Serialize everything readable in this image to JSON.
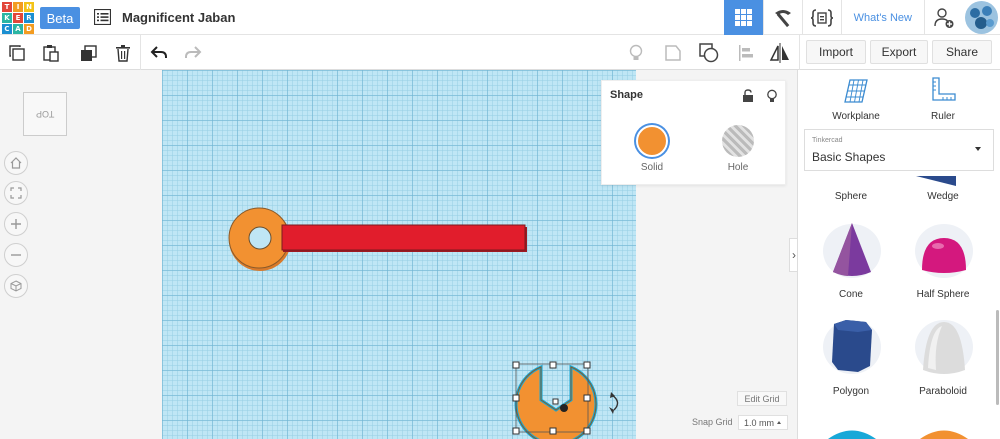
{
  "app": {
    "logo_letters": [
      "T",
      "I",
      "N",
      "K",
      "E",
      "R",
      "C",
      "A",
      "D"
    ],
    "logo_colors": [
      "#e2463a",
      "#f39c21",
      "#f3c318",
      "#2bb5a3",
      "#e2463a",
      "#1b8fd1",
      "#1b8fd1",
      "#2bb5a3",
      "#f39c21"
    ],
    "beta_label": "Beta",
    "design_title": "Magnificent Jaban",
    "whats_new_label": "What's New",
    "accent_color": "#4a90e2"
  },
  "toolbar": {
    "import_label": "Import",
    "export_label": "Export",
    "share_label": "Share"
  },
  "viewcube": {
    "face_label": "TOP"
  },
  "shape_panel": {
    "title": "Shape",
    "solid_label": "Solid",
    "hole_label": "Hole",
    "solid_color": "#f29131"
  },
  "grid_controls": {
    "edit_grid_label": "Edit Grid",
    "snap_grid_label": "Snap Grid",
    "snap_grid_value": "1.0 mm"
  },
  "sidebar": {
    "workplane_label": "Workplane",
    "ruler_label": "Ruler",
    "library_small": "Tinkercad",
    "library_value": "Basic Shapes",
    "shapes": [
      {
        "label": "Sphere"
      },
      {
        "label": "Wedge"
      },
      {
        "label": "Cone"
      },
      {
        "label": "Half Sphere"
      },
      {
        "label": "Polygon"
      },
      {
        "label": "Paraboloid"
      }
    ]
  }
}
